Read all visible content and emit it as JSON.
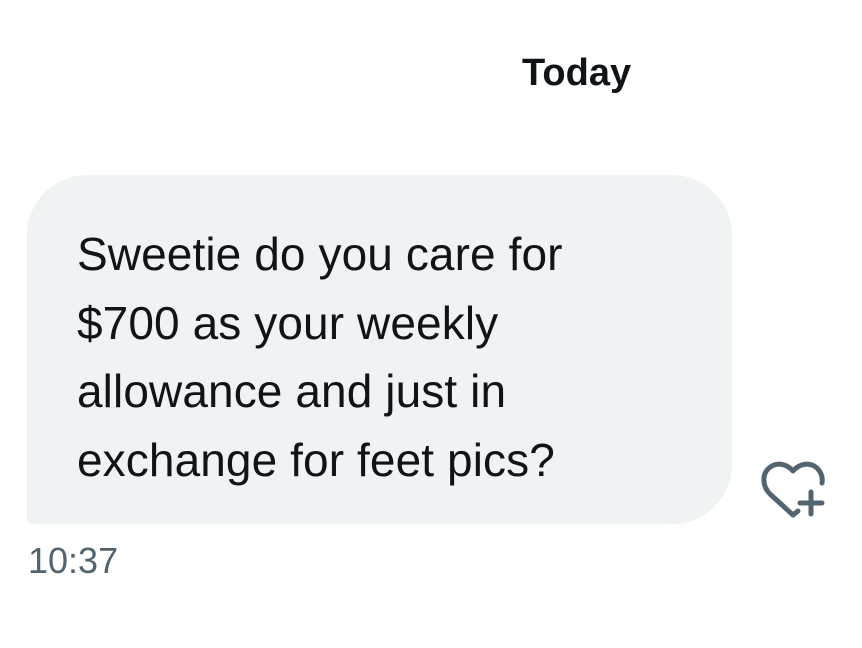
{
  "conversation": {
    "date_divider": "Today",
    "messages": [
      {
        "lines": [
          "Sweetie do you care for",
          "$700 as your weekly",
          "allowance and just in",
          "exchange for feet pics?"
        ],
        "time": "10:37",
        "reaction_icon": "heart-plus-icon"
      }
    ]
  },
  "colors": {
    "bubble_background": "#eff3f4",
    "text_primary": "#0f1419",
    "text_secondary": "#536471"
  }
}
